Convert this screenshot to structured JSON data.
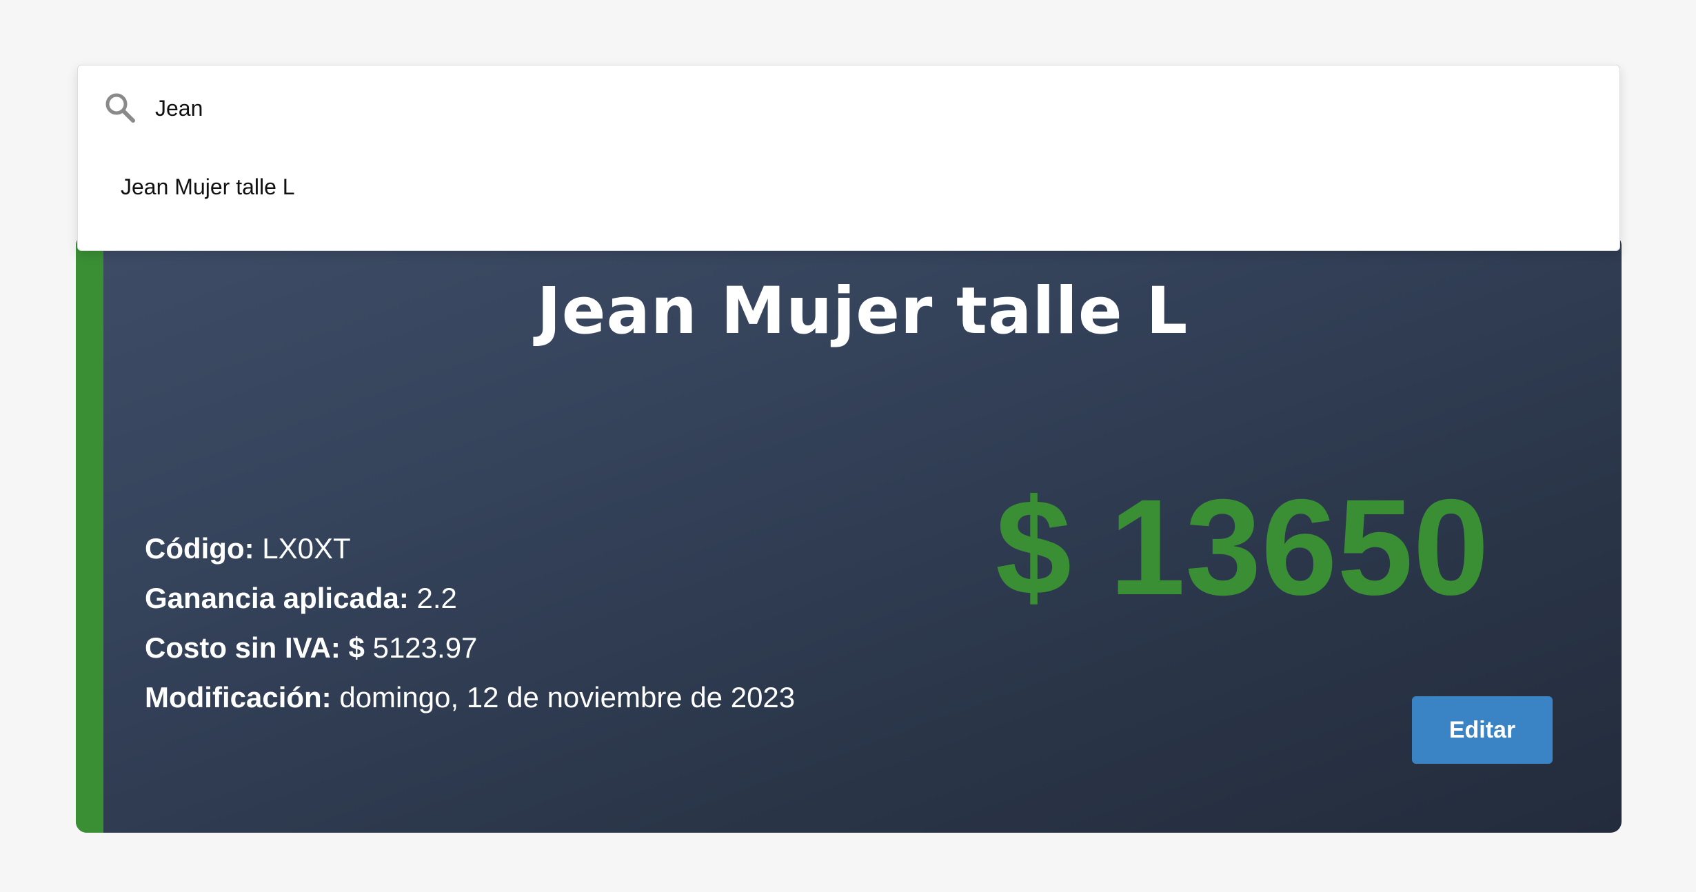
{
  "search": {
    "value": "Jean",
    "placeholder": "",
    "suggestions": [
      {
        "label": "Jean Mujer talle L"
      }
    ]
  },
  "product": {
    "title": "Jean Mujer talle L",
    "details": [
      {
        "label": "Código:",
        "value": "LX0XT"
      },
      {
        "label": "Ganancia aplicada:",
        "value": "2.2"
      },
      {
        "label": "Costo sin IVA: $",
        "value": "5123.97"
      },
      {
        "label": "Modificación:",
        "value": "domingo, 12 de noviembre de 2023"
      }
    ],
    "price": "$ 13650",
    "edit_label": "Editar"
  },
  "colors": {
    "accent_green": "#3a8f35",
    "button_blue": "#3a83c4",
    "card_bg_light": "#3e4c66",
    "card_bg_dark": "#232c3c",
    "page_bg": "#f6f6f6"
  },
  "icons": {
    "search": "search-icon"
  }
}
